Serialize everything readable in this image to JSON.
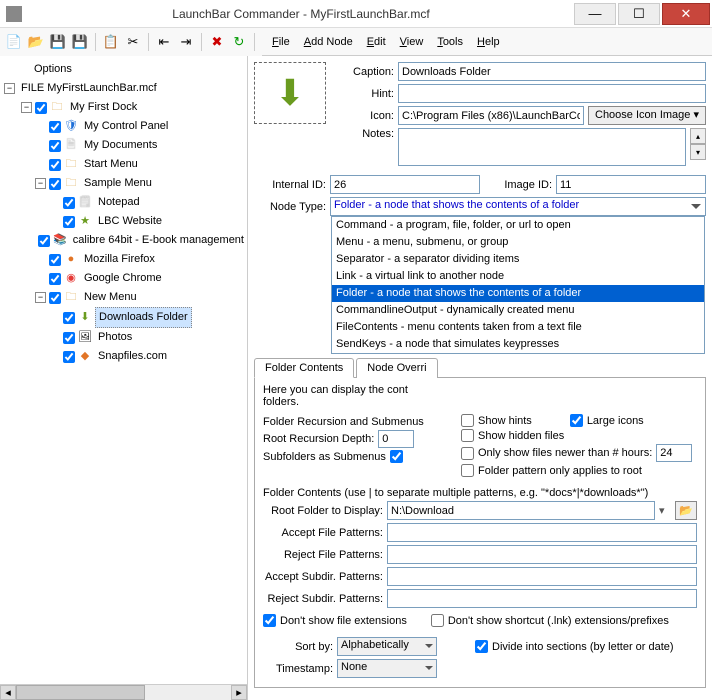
{
  "window": {
    "title": "LaunchBar Commander - MyFirstLaunchBar.mcf"
  },
  "menubar": {
    "file": "File",
    "addnode": "Add Node",
    "edit": "Edit",
    "view": "View",
    "tools": "Tools",
    "help": "Help"
  },
  "tree": {
    "options": "Options",
    "root": "FILE MyFirstLaunchBar.mcf",
    "dock": "My First Dock",
    "items": {
      "cp": "My Control Panel",
      "mydocs": "My Documents",
      "start": "Start Menu",
      "sample": "Sample Menu",
      "notepad": "Notepad",
      "lbc": "LBC Website",
      "calibre": "calibre 64bit - E-book management",
      "ff": "Mozilla Firefox",
      "chrome": "Google Chrome",
      "newmenu": "New Menu",
      "downloads": "Downloads Folder",
      "photos": "Photos",
      "snap": "Snapfiles.com"
    }
  },
  "props": {
    "caption_lbl": "Caption:",
    "caption": "Downloads Folder",
    "hint_lbl": "Hint:",
    "hint": "",
    "icon_lbl": "Icon:",
    "icon": "C:\\Program Files (x86)\\LaunchBarCo",
    "choose_icon": "Choose Icon Image  ▾",
    "notes_lbl": "Notes:",
    "internal_id_lbl": "Internal ID:",
    "internal_id": "26",
    "image_id_lbl": "Image ID:",
    "image_id": "11",
    "node_type_lbl": "Node Type:",
    "node_type_sel": "Folder - a node that shows the contents of a folder"
  },
  "node_types": [
    "Command - a program, file, folder, or url to open",
    "Menu - a menu, submenu, or group",
    "Separator - a separator dividing items",
    "Link - a virtual link to another node",
    "Folder - a node that shows the contents of a folder",
    "CommandlineOutput - dynamically created menu",
    "FileContents - menu contents taken from a text file",
    "SendKeys - a node that simulates keypresses"
  ],
  "tabs": {
    "fc": "Folder Contents",
    "no": "Node Overri"
  },
  "fc": {
    "intro": "Here you can display the cont",
    "intro2": "folders.",
    "grp1": "Folder Recursion and Submenus",
    "rrd_lbl": "Root Recursion Depth:",
    "rrd": "0",
    "sas_lbl": "Subfolders as Submenus",
    "show_hints": "Show hints",
    "large_icons": "Large icons",
    "show_hidden": "Show hidden files",
    "only_newer": "Only show files newer than # hours:",
    "only_newer_val": "24",
    "pattern_root": "Folder pattern only applies to root",
    "grp2": "Folder Contents (use | to separate multiple patterns, e.g. \"*docs*|*downloads*\")",
    "root_folder_lbl": "Root Folder to Display:",
    "root_folder": "N:\\Download",
    "afp_lbl": "Accept File Patterns:",
    "rfp_lbl": "Reject File Patterns:",
    "asp_lbl": "Accept Subdir. Patterns:",
    "rsp_lbl": "Reject Subdir. Patterns:",
    "dont_ext": "Don't show file extensions",
    "dont_lnk": "Don't show shortcut (.lnk) extensions/prefixes",
    "sortby_lbl": "Sort by:",
    "sortby": "Alphabetically",
    "divide": "Divide into sections (by letter or date)",
    "ts_lbl": "Timestamp:",
    "ts": "None"
  }
}
